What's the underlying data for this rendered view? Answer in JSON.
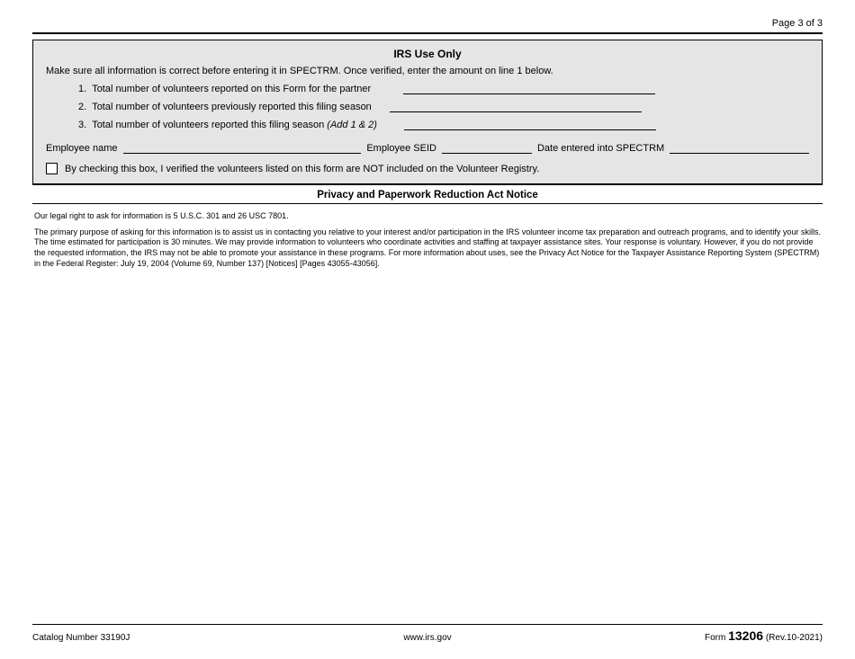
{
  "header": {
    "page_label": "Page 3 of 3"
  },
  "irs_box": {
    "title": "IRS Use Only",
    "instruction": "Make sure all information is correct before entering it in SPECTRM. Once verified, enter the amount on line 1 below.",
    "line1": {
      "num": "1.",
      "label": "Total number of volunteers reported on this Form for the partner",
      "value": ""
    },
    "line2": {
      "num": "2.",
      "label": "Total number of volunteers previously reported this filing season",
      "value": ""
    },
    "line3": {
      "num": "3.",
      "label_prefix": "Total number of volunteers reported this filing season ",
      "label_italic": "(Add 1 & 2)",
      "value": ""
    },
    "employee": {
      "name_label": "Employee name",
      "name_value": "",
      "seid_label": "Employee SEID",
      "seid_value": "",
      "date_label": "Date entered into SPECTRM",
      "date_value": ""
    },
    "checkbox_text": "By checking this box, I verified the volunteers listed on this form are NOT included on the Volunteer Registry."
  },
  "privacy": {
    "title": "Privacy and Paperwork Reduction Act Notice",
    "legal_line1": "Our legal right to ask for information is 5 U.S.C. 301 and 26 USC 7801.",
    "legal_para": "The primary purpose of asking for this information is to assist us in contacting you relative to your interest and/or participation in the IRS volunteer income tax preparation and outreach programs, and to identify your skills. The time estimated for participation is 30 minutes. We may provide information to volunteers who coordinate activities and staffing at taxpayer assistance sites. Your response is voluntary. However, if you do not provide the requested information, the IRS may not be able to promote your assistance in these programs. For more information about uses, see the Privacy Act Notice for the Taxpayer Assistance Reporting System (SPECTRM) in the Federal Register: July 19, 2004 (Volume 69, Number 137) [Notices] [Pages 43055-43056]."
  },
  "footer": {
    "catalog": "Catalog Number 33190J",
    "url": "www.irs.gov",
    "form_prefix": "Form ",
    "form_number": "13206",
    "revision": " (Rev.10-2021)"
  }
}
